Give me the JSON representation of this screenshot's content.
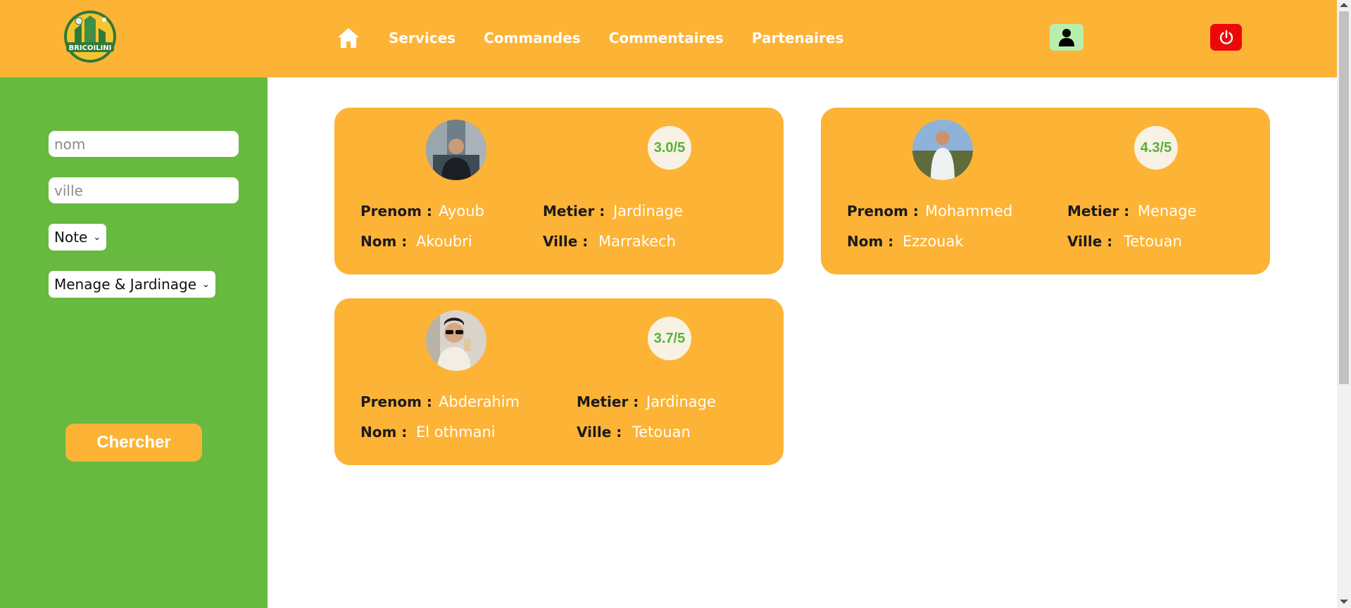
{
  "header": {
    "logo_text": "BRICOILINI",
    "nav": [
      "Services",
      "Commandes",
      "Commentaires",
      "Partenaires"
    ]
  },
  "sidebar": {
    "nom_placeholder": "nom",
    "ville_placeholder": "ville",
    "note_select": "Note",
    "category_select": "Menage & Jardinage",
    "search_button": "Chercher"
  },
  "labels": {
    "prenom": "Prenom :",
    "nom": "Nom :",
    "metier": "Metier :",
    "ville": "Ville :"
  },
  "cards": [
    {
      "rating": "3.0/5",
      "prenom": "Ayoub",
      "nom": "Akoubri",
      "metier": "Jardinage",
      "ville": "Marrakech"
    },
    {
      "rating": "4.3/5",
      "prenom": "Mohammed",
      "nom": "Ezzouak",
      "metier": "Menage",
      "ville": "Tetouan"
    },
    {
      "rating": "3.7/5",
      "prenom": "Abderahim",
      "nom": "El othmani",
      "metier": "Jardinage",
      "ville": "Tetouan"
    }
  ],
  "colors": {
    "header": "#fdb335",
    "sidebar": "#67b940",
    "rating_text": "#58b13a",
    "power_button": "#ee0707",
    "user_button": "#b8efad"
  }
}
